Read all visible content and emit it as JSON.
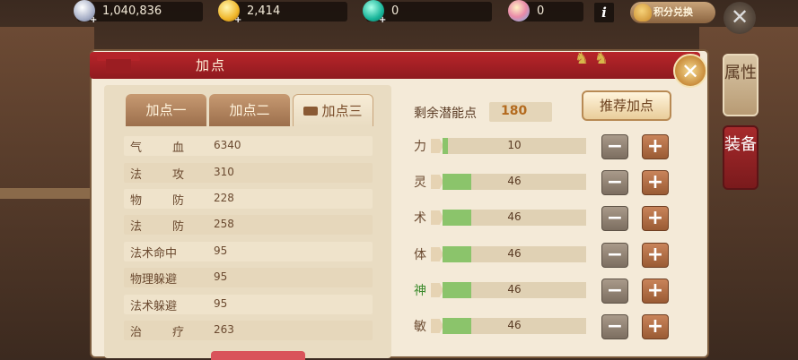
{
  "topbar": {
    "silver": "1,040,836",
    "gold": "2,414",
    "jade": "0",
    "gem": "0",
    "info_label": "i",
    "exchange_label": "积分兑换"
  },
  "panel": {
    "title": "加点",
    "close_symbol": "✕"
  },
  "side_tabs": [
    {
      "label": "属性"
    },
    {
      "label": "装备"
    }
  ],
  "tabs": [
    {
      "label": "加点一"
    },
    {
      "label": "加点二"
    },
    {
      "label": "加点三"
    }
  ],
  "stats": [
    {
      "name": "气血",
      "value": "6340"
    },
    {
      "name": "法攻",
      "value": "310"
    },
    {
      "name": "物防",
      "value": "228"
    },
    {
      "name": "法防",
      "value": "258"
    },
    {
      "name": "法术命中",
      "value": "95"
    },
    {
      "name": "物理躲避",
      "value": "95"
    },
    {
      "name": "法术躲避",
      "value": "95"
    },
    {
      "name": "治疗",
      "value": "263"
    }
  ],
  "potential": {
    "label": "剩余潜能点",
    "value": "180",
    "recommend_label": "推荐加点"
  },
  "attributes": [
    {
      "label": "力",
      "value": "10",
      "fill_fraction": 0.04
    },
    {
      "label": "灵",
      "value": "46",
      "fill_fraction": 0.2
    },
    {
      "label": "术",
      "value": "46",
      "fill_fraction": 0.2
    },
    {
      "label": "体",
      "value": "46",
      "fill_fraction": 0.2
    },
    {
      "label": "神",
      "value": "46",
      "fill_fraction": 0.2
    },
    {
      "label": "敏",
      "value": "46",
      "fill_fraction": 0.2
    }
  ],
  "controls": {
    "minus": "−",
    "plus": "+"
  },
  "colors": {
    "accent_red": "#b8252a",
    "bar_green": "#8bc46b",
    "remain_orange": "#b36a1e"
  }
}
